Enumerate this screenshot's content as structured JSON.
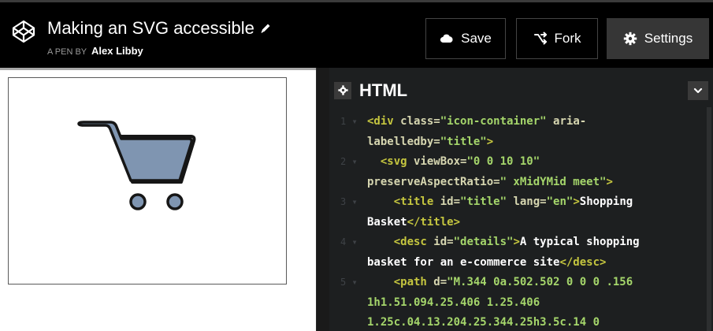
{
  "header": {
    "pen_title": "Making an SVG accessible",
    "byline_prefix": "A PEN BY",
    "author": "Alex Libby",
    "buttons": {
      "save": "Save",
      "fork": "Fork",
      "settings": "Settings"
    }
  },
  "editor": {
    "title": "HTML",
    "lines": [
      {
        "num": "1",
        "tokens": [
          {
            "c": "tag",
            "t": "<div "
          },
          {
            "c": "attr",
            "t": "class="
          },
          {
            "c": "str",
            "t": "\"icon-container\" "
          },
          {
            "c": "attr",
            "t": "aria-"
          }
        ]
      },
      {
        "num": "",
        "tokens": [
          {
            "c": "attr",
            "t": "labelledby="
          },
          {
            "c": "str",
            "t": "\"title\""
          },
          {
            "c": "tag",
            "t": ">"
          }
        ]
      },
      {
        "num": "2",
        "tokens": [
          {
            "c": "tag",
            "t": "  <svg "
          },
          {
            "c": "attr",
            "t": "viewBox="
          },
          {
            "c": "str",
            "t": "\"0 0 10 10\""
          }
        ]
      },
      {
        "num": "",
        "tokens": [
          {
            "c": "attr",
            "t": "preserveAspectRatio="
          },
          {
            "c": "str",
            "t": "\" xMidYMid meet\""
          },
          {
            "c": "tag",
            "t": ">"
          }
        ]
      },
      {
        "num": "3",
        "tokens": [
          {
            "c": "tag",
            "t": "    <title "
          },
          {
            "c": "attr",
            "t": "id="
          },
          {
            "c": "str",
            "t": "\"title\" "
          },
          {
            "c": "attr",
            "t": "lang="
          },
          {
            "c": "str",
            "t": "\"en\""
          },
          {
            "c": "tag",
            "t": ">"
          },
          {
            "c": "plain",
            "t": "Shopping"
          }
        ]
      },
      {
        "num": "",
        "tokens": [
          {
            "c": "plain",
            "t": "Basket"
          },
          {
            "c": "tag",
            "t": "</title>"
          }
        ]
      },
      {
        "num": "4",
        "tokens": [
          {
            "c": "tag",
            "t": "    <desc "
          },
          {
            "c": "attr",
            "t": "id="
          },
          {
            "c": "str",
            "t": "\"details\""
          },
          {
            "c": "tag",
            "t": ">"
          },
          {
            "c": "plain",
            "t": "A typical shopping"
          }
        ]
      },
      {
        "num": "",
        "tokens": [
          {
            "c": "plain",
            "t": "basket for an e-commerce site"
          },
          {
            "c": "tag",
            "t": "</desc>"
          }
        ]
      },
      {
        "num": "5",
        "tokens": [
          {
            "c": "tag",
            "t": "    <path "
          },
          {
            "c": "attr",
            "t": "d="
          },
          {
            "c": "str",
            "t": "\"M.344 0a.502.502 0 0 0 .156"
          }
        ]
      },
      {
        "num": "",
        "tokens": [
          {
            "c": "str",
            "t": "1h1.51.094.25.406 1.25.406"
          }
        ]
      },
      {
        "num": "",
        "tokens": [
          {
            "c": "str",
            "t": "1.25c.04.13.204.25.344.25h3.5c.14 0"
          }
        ]
      }
    ]
  },
  "preview": {
    "icon": "shopping-cart-icon",
    "cart_color": "#7f95b1"
  },
  "colors": {
    "header_bg": "#000000",
    "editor_bg": "#1d1f20",
    "tag": "#c5c63f",
    "attr": "#d6d6b0",
    "string": "#a5d66b"
  }
}
